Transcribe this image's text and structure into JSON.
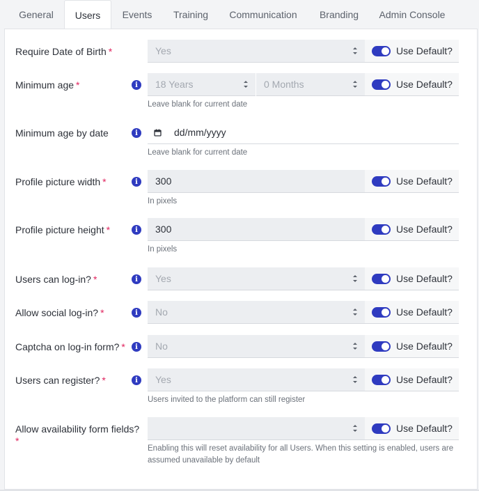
{
  "tabs": [
    {
      "label": "General"
    },
    {
      "label": "Users"
    },
    {
      "label": "Events"
    },
    {
      "label": "Training"
    },
    {
      "label": "Communication"
    },
    {
      "label": "Branding"
    },
    {
      "label": "Admin Console"
    }
  ],
  "active_tab": "Users",
  "required_mark": "*",
  "info_glyph": "i",
  "use_default_label": "Use Default?",
  "fields": {
    "dob": {
      "label": "Require Date of Birth",
      "value": "Yes",
      "use_default": true
    },
    "min_age": {
      "label": "Minimum age",
      "years": "18 Years",
      "months": "0 Months",
      "help": "Leave blank for current date",
      "use_default": true
    },
    "min_age_date": {
      "label": "Minimum age by date",
      "placeholder": "dd/mm/yyyy",
      "help": "Leave blank for current date"
    },
    "pic_width": {
      "label": "Profile picture width",
      "value": "300",
      "help": "In pixels",
      "use_default": true
    },
    "pic_height": {
      "label": "Profile picture height",
      "value": "300",
      "help": "In pixels",
      "use_default": true
    },
    "login": {
      "label": "Users can log-in?",
      "value": "Yes",
      "use_default": true
    },
    "social": {
      "label": "Allow social log-in?",
      "value": "No",
      "use_default": true
    },
    "captcha": {
      "label": "Captcha on log-in form?",
      "value": "No",
      "use_default": true
    },
    "register": {
      "label": "Users can register?",
      "value": "Yes",
      "help": "Users invited to the platform can still register",
      "use_default": true
    },
    "availability": {
      "label": "Allow availability form fields?",
      "value": "",
      "help": "Enabling this will reset availability for all Users. When this setting is enabled, users are assumed unavailable by default",
      "use_default": true
    }
  },
  "colors": {
    "accent": "#2f3bc0",
    "required": "#e0245e"
  }
}
